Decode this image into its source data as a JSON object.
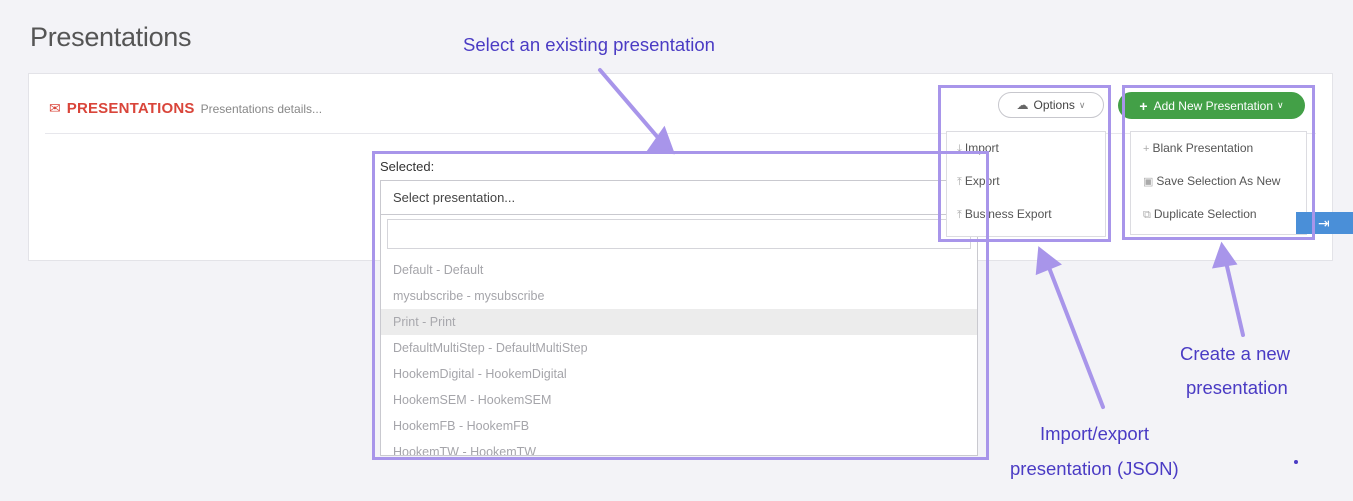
{
  "page": {
    "title": "Presentations"
  },
  "panel": {
    "icon": "comment-icon",
    "title": "PRESENTATIONS",
    "subtitle": "Presentations details..."
  },
  "selector": {
    "label": "Selected:",
    "placeholder": "Select presentation...",
    "items": [
      "Default - Default",
      "mysubscribe - mysubscribe",
      "Print - Print",
      "DefaultMultiStep - DefaultMultiStep",
      "HookemDigital - HookemDigital",
      "HookemSEM - HookemSEM",
      "HookemFB - HookemFB",
      "HookemTW - HookemTW"
    ],
    "active_index": 2
  },
  "options": {
    "label": "Options",
    "icon": "cloud-icon",
    "items": [
      {
        "label": "Import",
        "icon": "download-icon"
      },
      {
        "label": "Export",
        "icon": "upload-icon"
      },
      {
        "label": "Business Export",
        "icon": "upload-icon"
      }
    ]
  },
  "add_new": {
    "label": "Add New Presentation",
    "icon": "plus-icon",
    "items": [
      {
        "label": "Blank Presentation",
        "icon": "plus-icon"
      },
      {
        "label": "Save Selection As New",
        "icon": "save-icon"
      },
      {
        "label": "Duplicate Selection",
        "icon": "copy-icon"
      }
    ]
  },
  "side_tab": {
    "icon": "sign-in-icon"
  },
  "annotations": {
    "select_existing": "Select an existing presentation",
    "create_new_line1": "Create a new",
    "create_new_line2": "presentation",
    "import_export_line1": "Import/export",
    "import_export_line2": "presentation (JSON)"
  },
  "colors": {
    "brand_red": "#d9453a",
    "add_green": "#43a047",
    "annotation_purple": "#4a3bc4",
    "highlight_purple": "#a895ea",
    "side_tab_blue": "#4a8fd8"
  }
}
